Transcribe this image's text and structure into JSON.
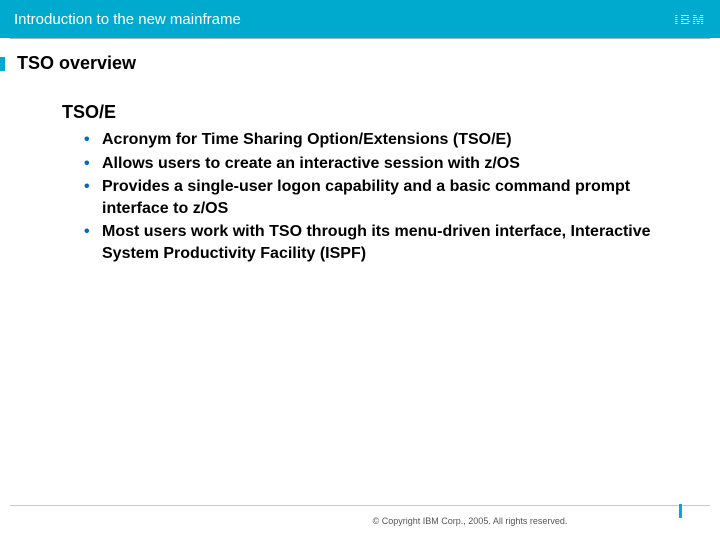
{
  "header": {
    "title": "Introduction to the new mainframe",
    "logo_text": "IBM"
  },
  "slide": {
    "title": "TSO overview",
    "sub_heading": "TSO/E",
    "bullets": [
      "Acronym for Time Sharing Option/Extensions (TSO/E)",
      "Allows users to create an interactive session with z/OS",
      "Provides a single-user logon capability and a basic command prompt interface to z/OS",
      "Most users work with TSO through its menu-driven interface, Interactive System Productivity Facility (ISPF)"
    ]
  },
  "footer": {
    "copyright": "© Copyright IBM Corp., 2005. All rights reserved."
  }
}
